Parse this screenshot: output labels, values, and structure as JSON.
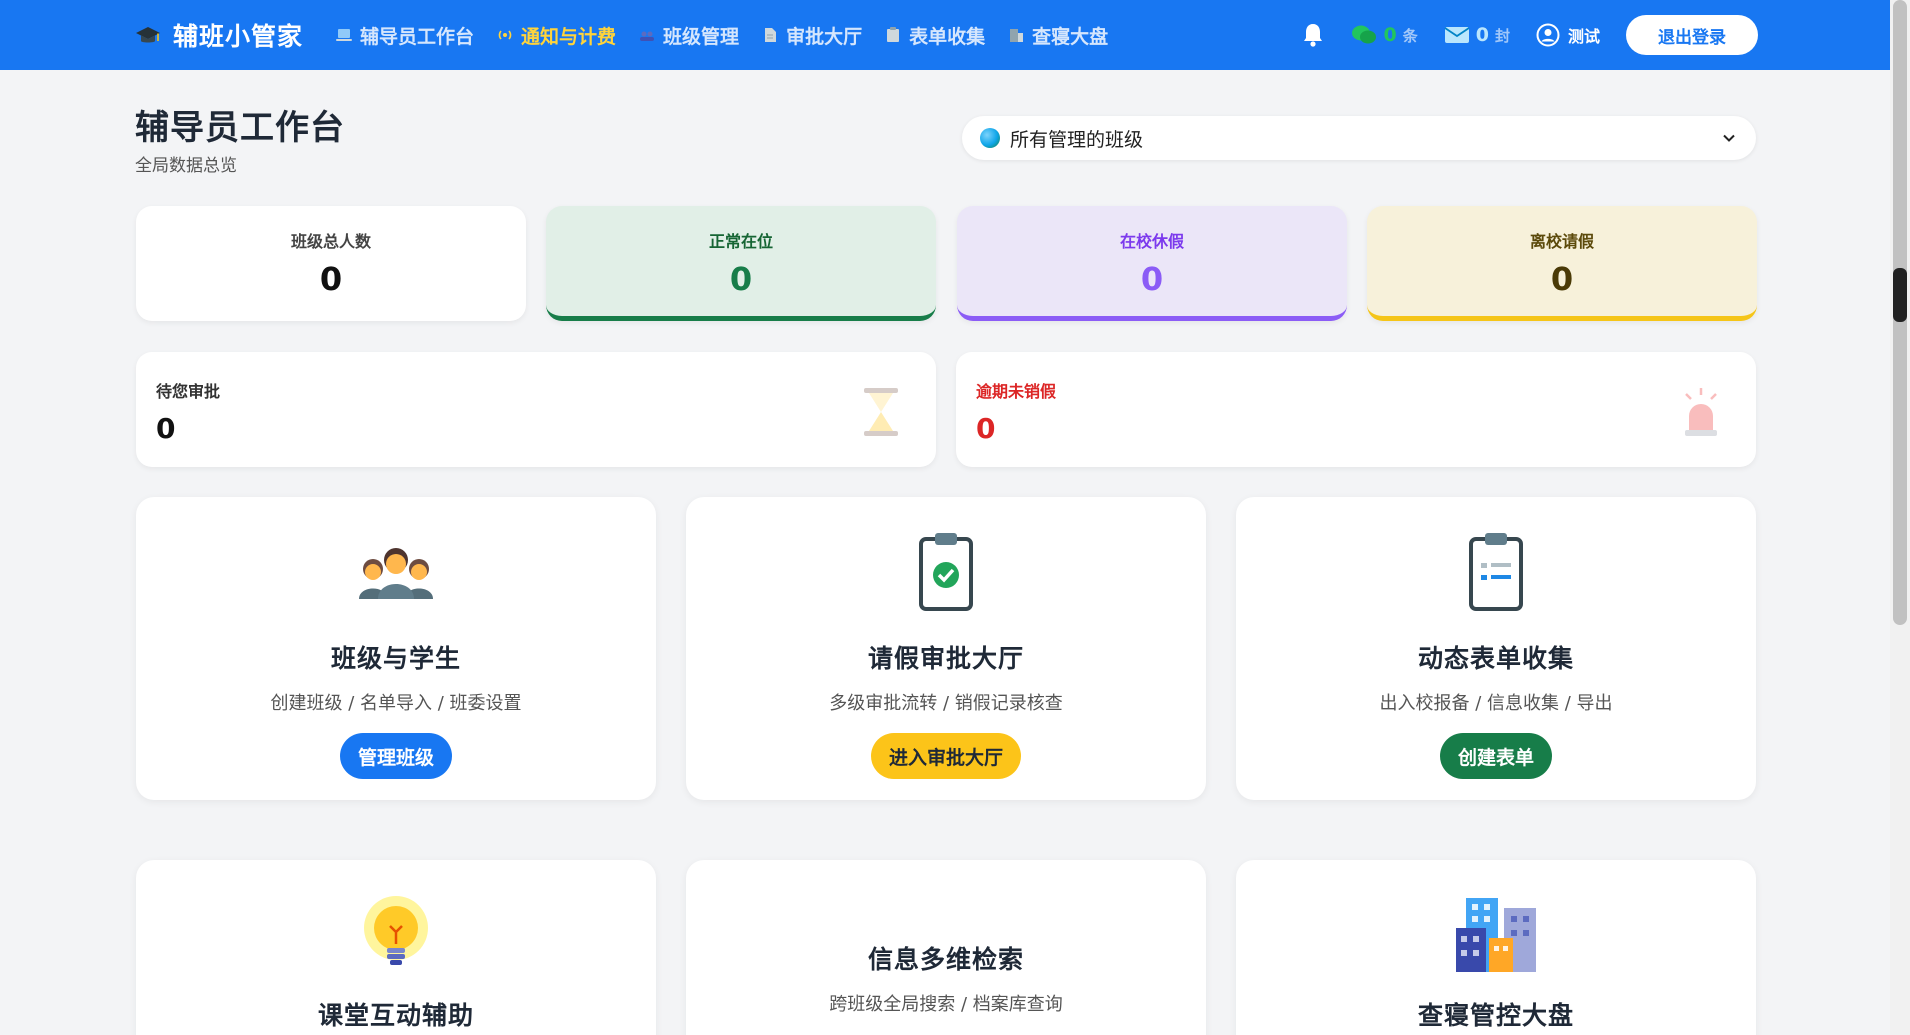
{
  "nav": {
    "brand": "辅班小管家",
    "links": [
      {
        "label": "辅导员工作台",
        "icon": "laptop-icon",
        "active": false
      },
      {
        "label": "通知与计费",
        "icon": "broadcast-icon",
        "active": true
      },
      {
        "label": "班级管理",
        "icon": "people-icon",
        "active": false
      },
      {
        "label": "审批大厅",
        "icon": "document-icon",
        "active": false
      },
      {
        "label": "表单收集",
        "icon": "clipboard-icon",
        "active": false
      },
      {
        "label": "查寝大盘",
        "icon": "building-icon",
        "active": false
      }
    ],
    "wechat_count": "0",
    "wechat_unit": "条",
    "mail_count": "0",
    "mail_unit": "封",
    "user_name": "测试",
    "logout_label": "退出登录"
  },
  "header": {
    "title": "辅导员工作台",
    "subtitle": "全局数据总览",
    "class_select": "所有管理的班级"
  },
  "stats": {
    "total": {
      "label": "班级总人数",
      "value": "0"
    },
    "present": {
      "label": "正常在位",
      "value": "0"
    },
    "school_leave": {
      "label": "在校休假",
      "value": "0"
    },
    "away_leave": {
      "label": "离校请假",
      "value": "0"
    }
  },
  "alerts": {
    "pending": {
      "label": "待您审批",
      "value": "0"
    },
    "overdue": {
      "label": "逾期未销假",
      "value": "0"
    }
  },
  "modules": [
    {
      "title": "班级与学生",
      "desc": "创建班级 / 名单导入 / 班委设置",
      "button": "管理班级",
      "icon": "people-group-icon"
    },
    {
      "title": "请假审批大厅",
      "desc": "多级审批流转 / 销假记录核查",
      "button": "进入审批大厅",
      "icon": "clipboard-check-icon"
    },
    {
      "title": "动态表单收集",
      "desc": "出入校报备 / 信息收集 / 导出",
      "button": "创建表单",
      "icon": "clipboard-list-icon"
    },
    {
      "title": "课堂互动辅助",
      "icon": "lightbulb-icon"
    },
    {
      "title": "信息多维检索",
      "desc": "跨班级全局搜索 / 档案库查询"
    },
    {
      "title": "查寝管控大盘",
      "icon": "buildings-icon"
    }
  ],
  "colors": {
    "nav_bg": "#1877f2",
    "active_nav": "#ffd43b",
    "present": "#177d49",
    "school_leave": "#8b5cf6",
    "away_leave": "#f5c518",
    "overdue": "#dc2626"
  }
}
